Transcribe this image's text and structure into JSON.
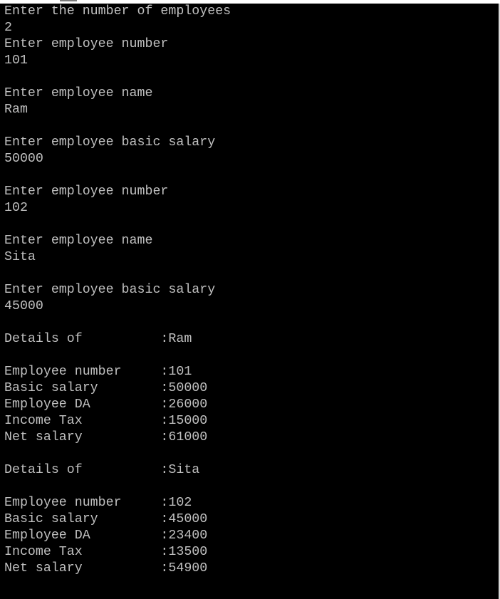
{
  "console": {
    "lines": [
      "Enter the number of employees",
      "2",
      "Enter employee number",
      "101",
      "",
      "Enter employee name",
      "Ram",
      "",
      "Enter employee basic salary",
      "50000",
      "",
      "Enter employee number",
      "102",
      "",
      "Enter employee name",
      "Sita",
      "",
      "Enter employee basic salary",
      "45000",
      "",
      "Details of          :Ram",
      "",
      "Employee number     :101",
      "Basic salary        :50000",
      "Employee DA         :26000",
      "Income Tax          :15000",
      "Net salary          :61000",
      "",
      "Details of          :Sita",
      "",
      "Employee number     :102",
      "Basic salary        :45000",
      "Employee DA         :23400",
      "Income Tax          :13500",
      "Net salary          :54900"
    ]
  },
  "colors": {
    "background": "#000000",
    "text": "#c0c0c0",
    "border": "#d9d9d9"
  }
}
